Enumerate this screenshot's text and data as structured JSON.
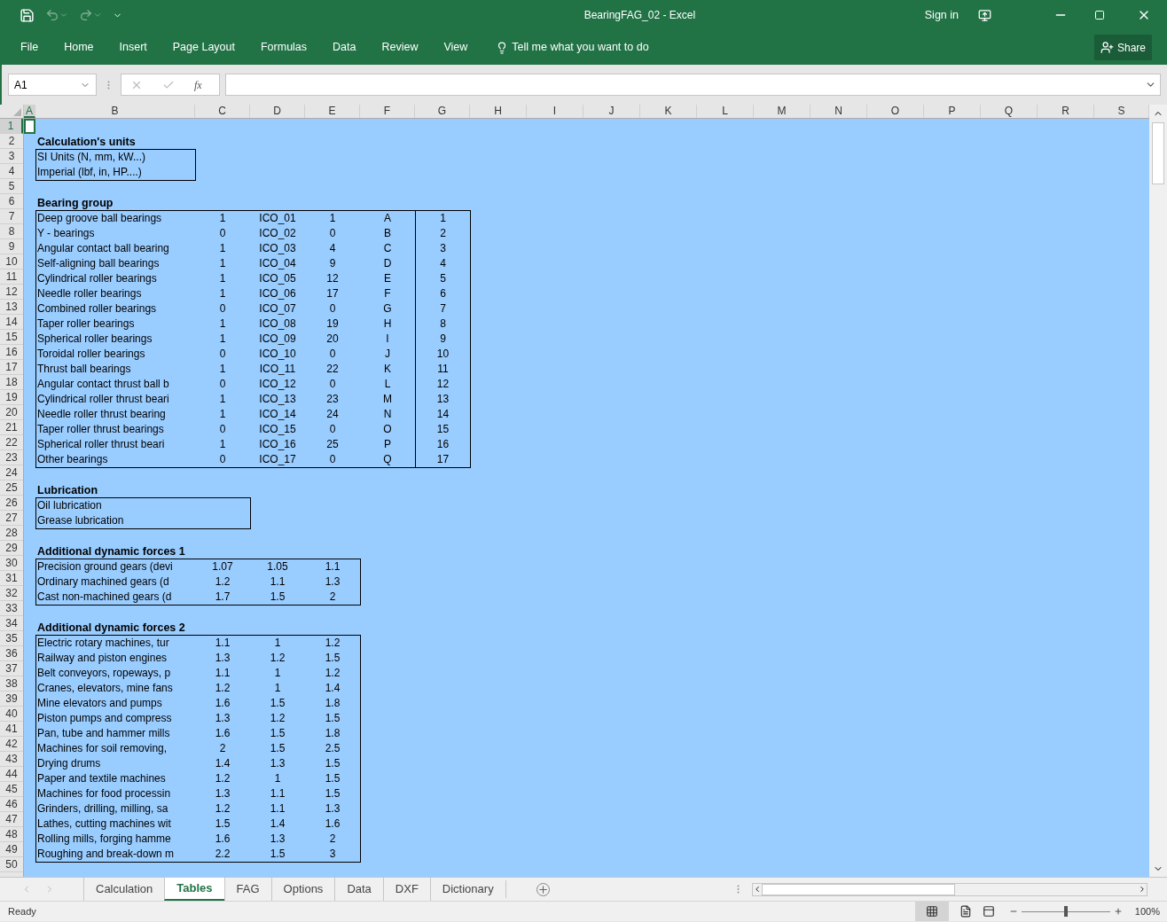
{
  "window": {
    "title": "BearingFAG_02 - Excel",
    "sign_in": "Sign in"
  },
  "ribbon": {
    "tabs": [
      "File",
      "Home",
      "Insert",
      "Page Layout",
      "Formulas",
      "Data",
      "Review",
      "View"
    ],
    "tell_me": "Tell me what you want to do",
    "share": "Share"
  },
  "formula_bar": {
    "name_box": "A1",
    "fx": "fx"
  },
  "sheet": {
    "columns": [
      {
        "label": "A",
        "selected": true
      },
      {
        "label": "B",
        "selected": false
      },
      {
        "label": "C",
        "selected": false
      },
      {
        "label": "D",
        "selected": false
      },
      {
        "label": "E",
        "selected": false
      },
      {
        "label": "F",
        "selected": false
      },
      {
        "label": "G",
        "selected": false
      },
      {
        "label": "H",
        "selected": false
      },
      {
        "label": "I",
        "selected": false
      },
      {
        "label": "J",
        "selected": false
      },
      {
        "label": "K",
        "selected": false
      },
      {
        "label": "L",
        "selected": false
      },
      {
        "label": "M",
        "selected": false
      },
      {
        "label": "N",
        "selected": false
      },
      {
        "label": "O",
        "selected": false
      },
      {
        "label": "P",
        "selected": false
      },
      {
        "label": "Q",
        "selected": false
      },
      {
        "label": "R",
        "selected": false
      },
      {
        "label": "S",
        "selected": false
      }
    ],
    "row_numbers": [
      {
        "label": "1",
        "selected": true
      },
      {
        "label": "2",
        "selected": false
      },
      {
        "label": "3",
        "selected": false
      },
      {
        "label": "4",
        "selected": false
      },
      {
        "label": "5",
        "selected": false
      },
      {
        "label": "6",
        "selected": false
      },
      {
        "label": "7",
        "selected": false
      },
      {
        "label": "8",
        "selected": false
      },
      {
        "label": "9",
        "selected": false
      },
      {
        "label": "10",
        "selected": false
      },
      {
        "label": "11",
        "selected": false
      },
      {
        "label": "12",
        "selected": false
      },
      {
        "label": "13",
        "selected": false
      },
      {
        "label": "14",
        "selected": false
      },
      {
        "label": "15",
        "selected": false
      },
      {
        "label": "16",
        "selected": false
      },
      {
        "label": "17",
        "selected": false
      },
      {
        "label": "18",
        "selected": false
      },
      {
        "label": "19",
        "selected": false
      },
      {
        "label": "20",
        "selected": false
      },
      {
        "label": "21",
        "selected": false
      },
      {
        "label": "22",
        "selected": false
      },
      {
        "label": "23",
        "selected": false
      },
      {
        "label": "24",
        "selected": false
      },
      {
        "label": "25",
        "selected": false
      },
      {
        "label": "26",
        "selected": false
      },
      {
        "label": "27",
        "selected": false
      },
      {
        "label": "28",
        "selected": false
      },
      {
        "label": "29",
        "selected": false
      },
      {
        "label": "30",
        "selected": false
      },
      {
        "label": "31",
        "selected": false
      },
      {
        "label": "32",
        "selected": false
      },
      {
        "label": "33",
        "selected": false
      },
      {
        "label": "34",
        "selected": false
      },
      {
        "label": "35",
        "selected": false
      },
      {
        "label": "36",
        "selected": false
      },
      {
        "label": "37",
        "selected": false
      },
      {
        "label": "38",
        "selected": false
      },
      {
        "label": "39",
        "selected": false
      },
      {
        "label": "40",
        "selected": false
      },
      {
        "label": "41",
        "selected": false
      },
      {
        "label": "42",
        "selected": false
      },
      {
        "label": "43",
        "selected": false
      },
      {
        "label": "44",
        "selected": false
      },
      {
        "label": "45",
        "selected": false
      },
      {
        "label": "46",
        "selected": false
      },
      {
        "label": "47",
        "selected": false
      },
      {
        "label": "48",
        "selected": false
      },
      {
        "label": "49",
        "selected": false
      },
      {
        "label": "50",
        "selected": false
      }
    ],
    "sections": [
      {
        "title": "Calculation's units",
        "kind": "narrow",
        "rows": [
          [
            "SI Units (N, mm, kW...)"
          ],
          [
            "Imperial (lbf, in, HP....)"
          ]
        ]
      },
      {
        "title": "Bearing group",
        "kind": "indexed",
        "rows": [
          [
            "Deep groove ball bearings",
            "1",
            "ICO_01",
            "1",
            "A",
            "1"
          ],
          [
            "Y - bearings",
            "0",
            "ICO_02",
            "0",
            "B",
            "2"
          ],
          [
            "Angular contact ball bearing",
            "1",
            "ICO_03",
            "4",
            "C",
            "3"
          ],
          [
            "Self-aligning ball bearings",
            "1",
            "ICO_04",
            "9",
            "D",
            "4"
          ],
          [
            "Cylindrical roller bearings",
            "1",
            "ICO_05",
            "12",
            "E",
            "5"
          ],
          [
            "Needle roller bearings",
            "1",
            "ICO_06",
            "17",
            "F",
            "6"
          ],
          [
            "Combined roller bearings",
            "0",
            "ICO_07",
            "0",
            "G",
            "7"
          ],
          [
            "Taper roller bearings",
            "1",
            "ICO_08",
            "19",
            "H",
            "8"
          ],
          [
            "Spherical roller bearings",
            "1",
            "ICO_09",
            "20",
            "I",
            "9"
          ],
          [
            "Toroidal roller bearings",
            "0",
            "ICO_10",
            "0",
            "J",
            "10"
          ],
          [
            "Thrust ball bearings",
            "1",
            "ICO_11",
            "22",
            "K",
            "11"
          ],
          [
            "Angular contact thrust ball b",
            "0",
            "ICO_12",
            "0",
            "L",
            "12"
          ],
          [
            "Cylindrical roller thrust beari",
            "1",
            "ICO_13",
            "23",
            "M",
            "13"
          ],
          [
            "Needle roller thrust bearing",
            "1",
            "ICO_14",
            "24",
            "N",
            "14"
          ],
          [
            "Taper roller thrust bearings",
            "0",
            "ICO_15",
            "0",
            "O",
            "15"
          ],
          [
            "Spherical roller thrust beari",
            "1",
            "ICO_16",
            "25",
            "P",
            "16"
          ],
          [
            "Other bearings",
            "0",
            "ICO_17",
            "0",
            "Q",
            "17"
          ]
        ]
      },
      {
        "title": "Lubrication",
        "kind": "wide",
        "rows": [
          [
            "Oil lubrication"
          ],
          [
            "Grease lubrication"
          ]
        ]
      },
      {
        "title": "Additional dynamic forces 1",
        "kind": "table",
        "rows": [
          [
            "Precision ground gears (devi",
            "1.07",
            "1.05",
            "1.1"
          ],
          [
            "Ordinary machined gears (d",
            "1.2",
            "1.1",
            "1.3"
          ],
          [
            "Cast non-machined gears (d",
            "1.7",
            "1.5",
            "2"
          ]
        ]
      },
      {
        "title": "Additional dynamic forces 2",
        "kind": "table",
        "rows": [
          [
            "Electric rotary machines, tur",
            "1.1",
            "1",
            "1.2"
          ],
          [
            "Railway and piston engines",
            "1.3",
            "1.2",
            "1.5"
          ],
          [
            "Belt conveyors, ropeways, p",
            "1.1",
            "1",
            "1.2"
          ],
          [
            "Cranes, elevators, mine fans",
            "1.2",
            "1",
            "1.4"
          ],
          [
            "Mine elevators and pumps",
            "1.6",
            "1.5",
            "1.8"
          ],
          [
            "Piston pumps and compress",
            "1.3",
            "1.2",
            "1.5"
          ],
          [
            "Pan, tube and hammer mills",
            "1.6",
            "1.5",
            "1.8"
          ],
          [
            "Machines for soil removing,",
            "2",
            "1.5",
            "2.5"
          ],
          [
            "Drying drums",
            "1.4",
            "1.3",
            "1.5"
          ],
          [
            "Paper and textile machines",
            "1.2",
            "1",
            "1.5"
          ],
          [
            "Machines for food processin",
            "1.3",
            "1.1",
            "1.5"
          ],
          [
            "Grinders, drilling, milling, sa",
            "1.2",
            "1.1",
            "1.3"
          ],
          [
            "Lathes, cutting machines wit",
            "1.5",
            "1.4",
            "1.6"
          ],
          [
            "Rolling mills, forging hamme",
            "1.6",
            "1.3",
            "2"
          ],
          [
            "Roughing and break-down m",
            "2.2",
            "1.5",
            "3"
          ]
        ]
      }
    ]
  },
  "sheet_tabs": [
    {
      "label": "Calculation",
      "selected": false
    },
    {
      "label": "Tables",
      "selected": true
    },
    {
      "label": "FAG",
      "selected": false
    },
    {
      "label": "Options",
      "selected": false
    },
    {
      "label": "Data",
      "selected": false
    },
    {
      "label": "DXF",
      "selected": false
    },
    {
      "label": "Dictionary",
      "selected": false
    }
  ],
  "status_bar": {
    "status": "Ready",
    "zoom": "100%",
    "zoom_slider": {
      "level": 0.5
    }
  }
}
